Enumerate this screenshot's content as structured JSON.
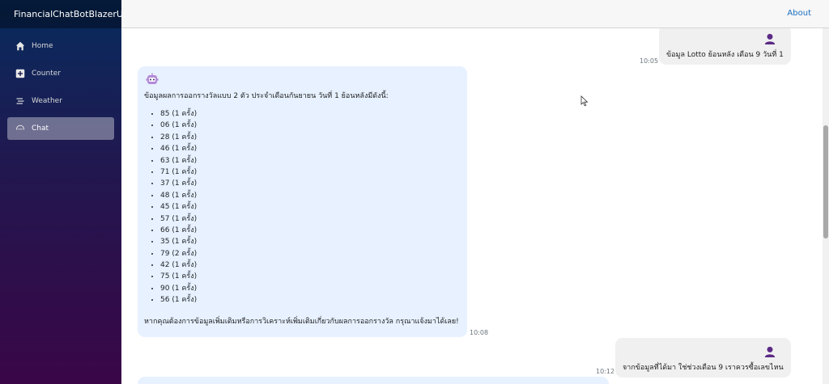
{
  "app": {
    "title": "FinancialChatBotBlazerUI"
  },
  "sidebar": {
    "items": [
      {
        "label": "Home",
        "icon": "home-icon"
      },
      {
        "label": "Counter",
        "icon": "plus-square-icon"
      },
      {
        "label": "Weather",
        "icon": "list-icon"
      },
      {
        "label": "Chat",
        "icon": "chat-icon"
      }
    ]
  },
  "topbar": {
    "about_label": "About"
  },
  "chat": {
    "messages": [
      {
        "role": "user",
        "text": "ข้อมูล Lotto ย้อนหลัง เดือน 9 วันที่ 1",
        "time": "10:05"
      },
      {
        "role": "bot",
        "intro": "ข้อมูลผลการออกรางวัลแบบ 2 ตัว ประจำเดือนกันยายน วันที่ 1 ย้อนหลังมีดังนี้:",
        "items": [
          "85 (1 ครั้ง)",
          "06 (1 ครั้ง)",
          "28 (1 ครั้ง)",
          "46 (1 ครั้ง)",
          "63 (1 ครั้ง)",
          "71 (1 ครั้ง)",
          "37 (1 ครั้ง)",
          "48 (1 ครั้ง)",
          "45 (1 ครั้ง)",
          "57 (1 ครั้ง)",
          "66 (1 ครั้ง)",
          "35 (1 ครั้ง)",
          "79 (2 ครั้ง)",
          "42 (1 ครั้ง)",
          "75 (1 ครั้ง)",
          "90 (1 ครั้ง)",
          "56 (1 ครั้ง)"
        ],
        "outro": "หากคุณต้องการข้อมูลเพิ่มเติมหรือการวิเคราะห์เพิ่มเติมเกี่ยวกับผลการออกรางวัล กรุณาแจ้งมาได้เลย!",
        "time": "10:08"
      },
      {
        "role": "user",
        "text": "จากข้อมูลที่ได้มา ใช่ช่วงเดือน 9 เราควรซื้อเลขไหน",
        "time": "10:12"
      }
    ]
  },
  "colors": {
    "accent": "#1b6ec2",
    "bot_bubble": "#e7f1ff",
    "user_bubble": "#f0f0f0",
    "avatar": "#5b2a86"
  }
}
